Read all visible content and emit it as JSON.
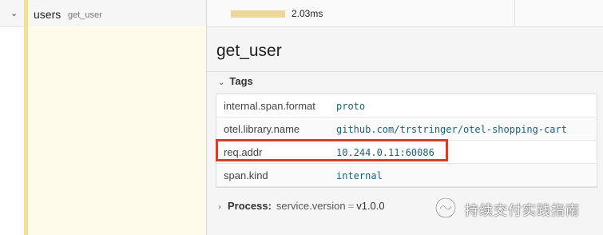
{
  "trace_row": {
    "service": "users",
    "operation": "get_user",
    "duration": "2.03ms"
  },
  "detail": {
    "title": "get_user",
    "tags_label": "Tags",
    "tags": [
      {
        "key": "internal.span.format",
        "value": "proto"
      },
      {
        "key": "otel.library.name",
        "value": "github.com/trstringer/otel-shopping-cart"
      },
      {
        "key": "req.addr",
        "value": "10.244.0.11:60086"
      },
      {
        "key": "span.kind",
        "value": "internal"
      }
    ],
    "process_label": "Process:",
    "process_key": "service.version",
    "process_eq": "=",
    "process_value": "v1.0.0"
  },
  "watermark": {
    "text": "持续交付实践指南"
  },
  "colors": {
    "span_bar": "#ebd79a",
    "highlight": "#d43e2c",
    "tag_value": "#1d5f77"
  }
}
